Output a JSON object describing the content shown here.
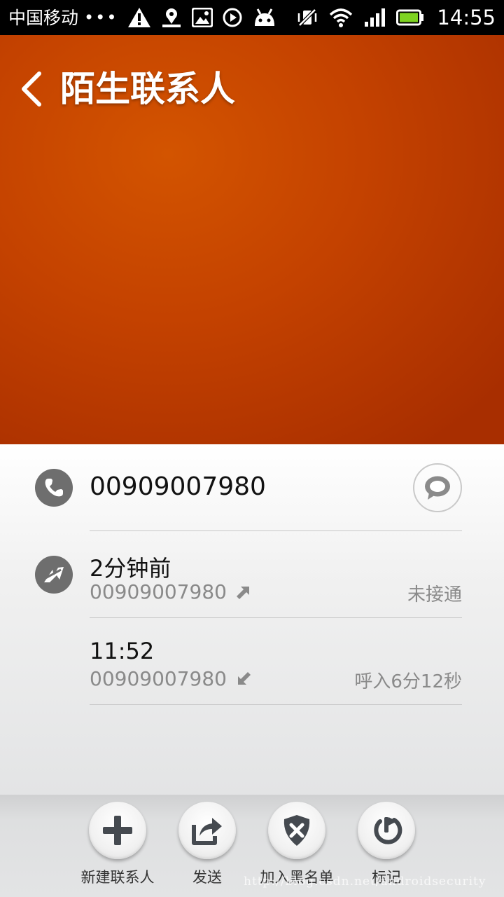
{
  "status_bar": {
    "carrier": "中国移动",
    "dots": "•••",
    "time": "14:55",
    "icons": [
      "warning-icon",
      "map-pin-icon",
      "image-icon",
      "play-icon",
      "android-icon",
      "vibrate-off-icon",
      "wifi-icon",
      "signal-icon",
      "battery-icon"
    ]
  },
  "header": {
    "title": "陌生联系人",
    "accent_color": "#c44200"
  },
  "contact": {
    "phone_number": "00909007980"
  },
  "call_log": [
    {
      "time": "2分钟前",
      "number": "00909007980",
      "direction_icon": "outgoing-arrow-icon",
      "status": "未接通"
    },
    {
      "time": "11:52",
      "number": "00909007980",
      "direction_icon": "incoming-arrow-icon",
      "status": "呼入6分12秒"
    }
  ],
  "toolbar": {
    "new_contact_label": "新建联系人",
    "send_label": "发送",
    "blacklist_label": "加入黑名单",
    "mark_label": "标记"
  },
  "watermark": "http://blog.csdn.net/androidsecurity"
}
